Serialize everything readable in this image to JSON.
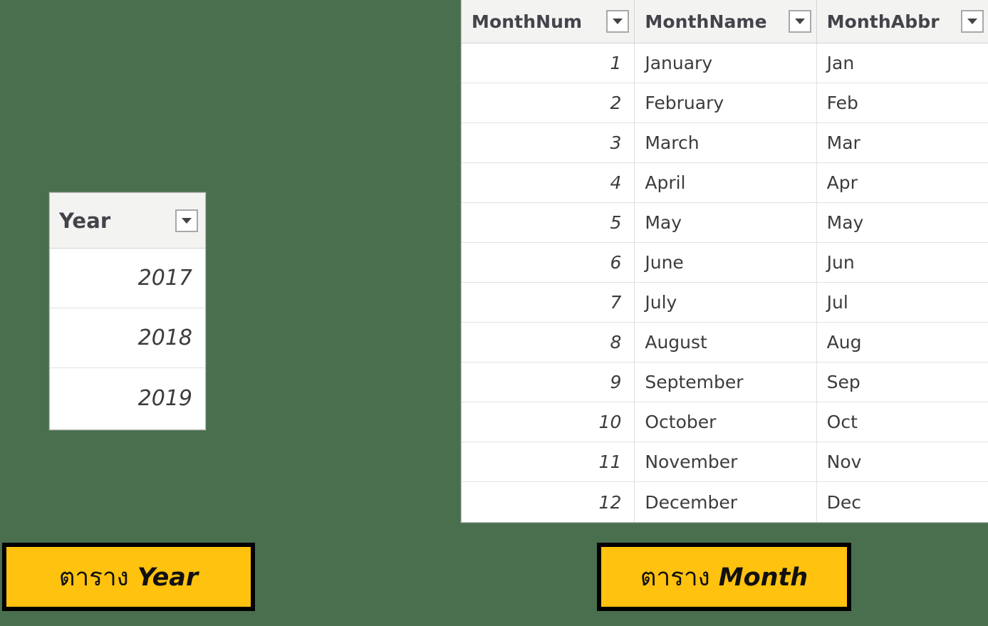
{
  "background_color": "#4a6f4f",
  "accent_color": "#ffc20e",
  "year_table": {
    "name": "Year",
    "columns": [
      {
        "label": "Year",
        "align": "right",
        "filter_icon": "chevron-down-icon"
      }
    ],
    "rows": [
      {
        "year": "2017"
      },
      {
        "year": "2018"
      },
      {
        "year": "2019"
      }
    ]
  },
  "month_table": {
    "name": "Month",
    "columns": [
      {
        "label": "MonthNum",
        "align": "right",
        "filter_icon": "chevron-down-icon"
      },
      {
        "label": "MonthName",
        "align": "left",
        "filter_icon": "chevron-down-icon"
      },
      {
        "label": "MonthAbbr",
        "align": "left",
        "filter_icon": "chevron-down-icon"
      }
    ],
    "rows": [
      {
        "num": "1",
        "name": "January",
        "abbr": "Jan"
      },
      {
        "num": "2",
        "name": "February",
        "abbr": "Feb"
      },
      {
        "num": "3",
        "name": "March",
        "abbr": "Mar"
      },
      {
        "num": "4",
        "name": "April",
        "abbr": "Apr"
      },
      {
        "num": "5",
        "name": "May",
        "abbr": "May"
      },
      {
        "num": "6",
        "name": "June",
        "abbr": "Jun"
      },
      {
        "num": "7",
        "name": "July",
        "abbr": "Jul"
      },
      {
        "num": "8",
        "name": "August",
        "abbr": "Aug"
      },
      {
        "num": "9",
        "name": "September",
        "abbr": "Sep"
      },
      {
        "num": "10",
        "name": "October",
        "abbr": "Oct"
      },
      {
        "num": "11",
        "name": "November",
        "abbr": "Nov"
      },
      {
        "num": "12",
        "name": "December",
        "abbr": "Dec"
      }
    ]
  },
  "captions": {
    "year": {
      "prefix": "ตาราง",
      "name": "Year"
    },
    "month": {
      "prefix": "ตาราง",
      "name": "Month"
    }
  }
}
